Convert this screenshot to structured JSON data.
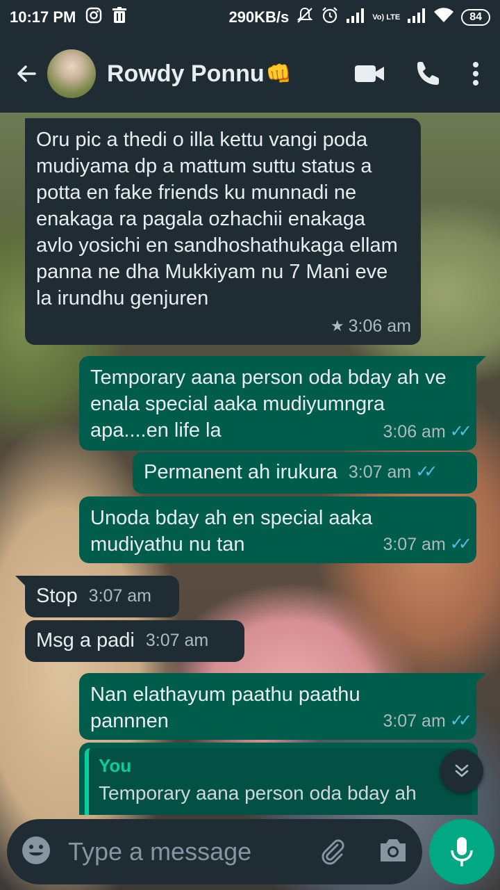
{
  "status_bar": {
    "time": "10:17 PM",
    "network_speed": "290KB/s",
    "lte_label": "Vo) LTE",
    "battery": "84",
    "icons": [
      "instagram-icon",
      "trash-icon",
      "mute-icon",
      "alarm-icon",
      "signal-icon",
      "lte-icon",
      "signal-icon",
      "wifi-icon",
      "battery-icon"
    ]
  },
  "header": {
    "contact_name": "Rowdy Ponnu",
    "contact_emoji": "👊",
    "icons": [
      "back-arrow-icon",
      "avatar",
      "video-call-icon",
      "phone-call-icon",
      "more-options-icon"
    ]
  },
  "messages": [
    {
      "dir": "in",
      "text": "Oru pic a thedi o illa kettu vangi poda mudiyama dp a mattum suttu status a potta en fake friends ku munnadi ne enakaga ra pagala ozhachii enakaga avlo yosichi en sandhoshathukaga ellam panna ne dha Mukkiyam nu 7 Mani eve la irundhu genjuren",
      "time": "3:06 am",
      "starred": true
    },
    {
      "dir": "out",
      "text": "Temporary aana person oda bday ah ve enala special aaka mudiyumngra apa....en life la",
      "time": "3:06 am",
      "read": true
    },
    {
      "dir": "out",
      "text": "Permanent ah irukura",
      "time": "3:07 am",
      "read": true
    },
    {
      "dir": "out",
      "text": "Unoda bday ah en special aaka mudiyathu nu tan",
      "time": "3:07 am",
      "read": true
    },
    {
      "dir": "in",
      "text": "Stop",
      "time": "3:07 am"
    },
    {
      "dir": "in",
      "text": "Msg a padi",
      "time": "3:07 am"
    },
    {
      "dir": "out",
      "text": "Nan elathayum paathu paathu pannnen",
      "time": "3:07 am",
      "read": true
    },
    {
      "dir": "out",
      "quote_author": "You",
      "quote_text": "Temporary aana person oda bday ah"
    }
  ],
  "input": {
    "placeholder": "Type a message",
    "icons": [
      "emoji-icon",
      "attach-icon",
      "camera-icon",
      "mic-icon"
    ]
  },
  "colors": {
    "header_bg": "#1f2c33",
    "incoming_bubble": "#1f2c33",
    "outgoing_bubble": "#005c4b",
    "read_ticks": "#53bdeb",
    "accent": "#00a884"
  }
}
